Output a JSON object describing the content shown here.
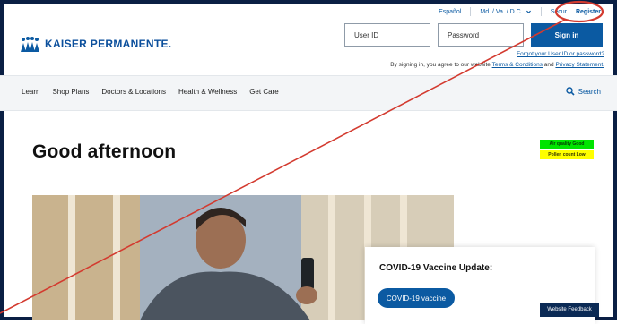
{
  "topbar": {
    "espanol": "Español",
    "region": "Md. / Va. / D.C.",
    "secure": "Secur",
    "register": "Register"
  },
  "brand": {
    "name": "KAISER PERMANENTE."
  },
  "login": {
    "user_placeholder": "User ID",
    "password_placeholder": "Password",
    "signin": "Sign in",
    "forgot": "Forgot your User ID or password?",
    "terms_prefix": "By signing in, you agree to our website ",
    "terms_link": "Terms & Conditions",
    "terms_and": " and ",
    "privacy_link": "Privacy Statement."
  },
  "nav": {
    "items": [
      "Learn",
      "Shop Plans",
      "Doctors & Locations",
      "Health & Wellness",
      "Get Care"
    ],
    "search": "Search"
  },
  "main": {
    "greeting": "Good afternoon"
  },
  "air": {
    "quality": "Air quality Good",
    "pollen": "Pollen count Low"
  },
  "covid": {
    "title": "COVID-19 Vaccine Update:",
    "button": "COVID-19 vaccine"
  },
  "feedback": "Website Feedback",
  "colors": {
    "brand_blue": "#0b5aa2",
    "navy": "#0a1f44",
    "annotation_red": "#d33a2f"
  },
  "icons": {
    "logo": "kp-logo",
    "search": "search-icon",
    "chevron": "chevron-down-icon"
  }
}
